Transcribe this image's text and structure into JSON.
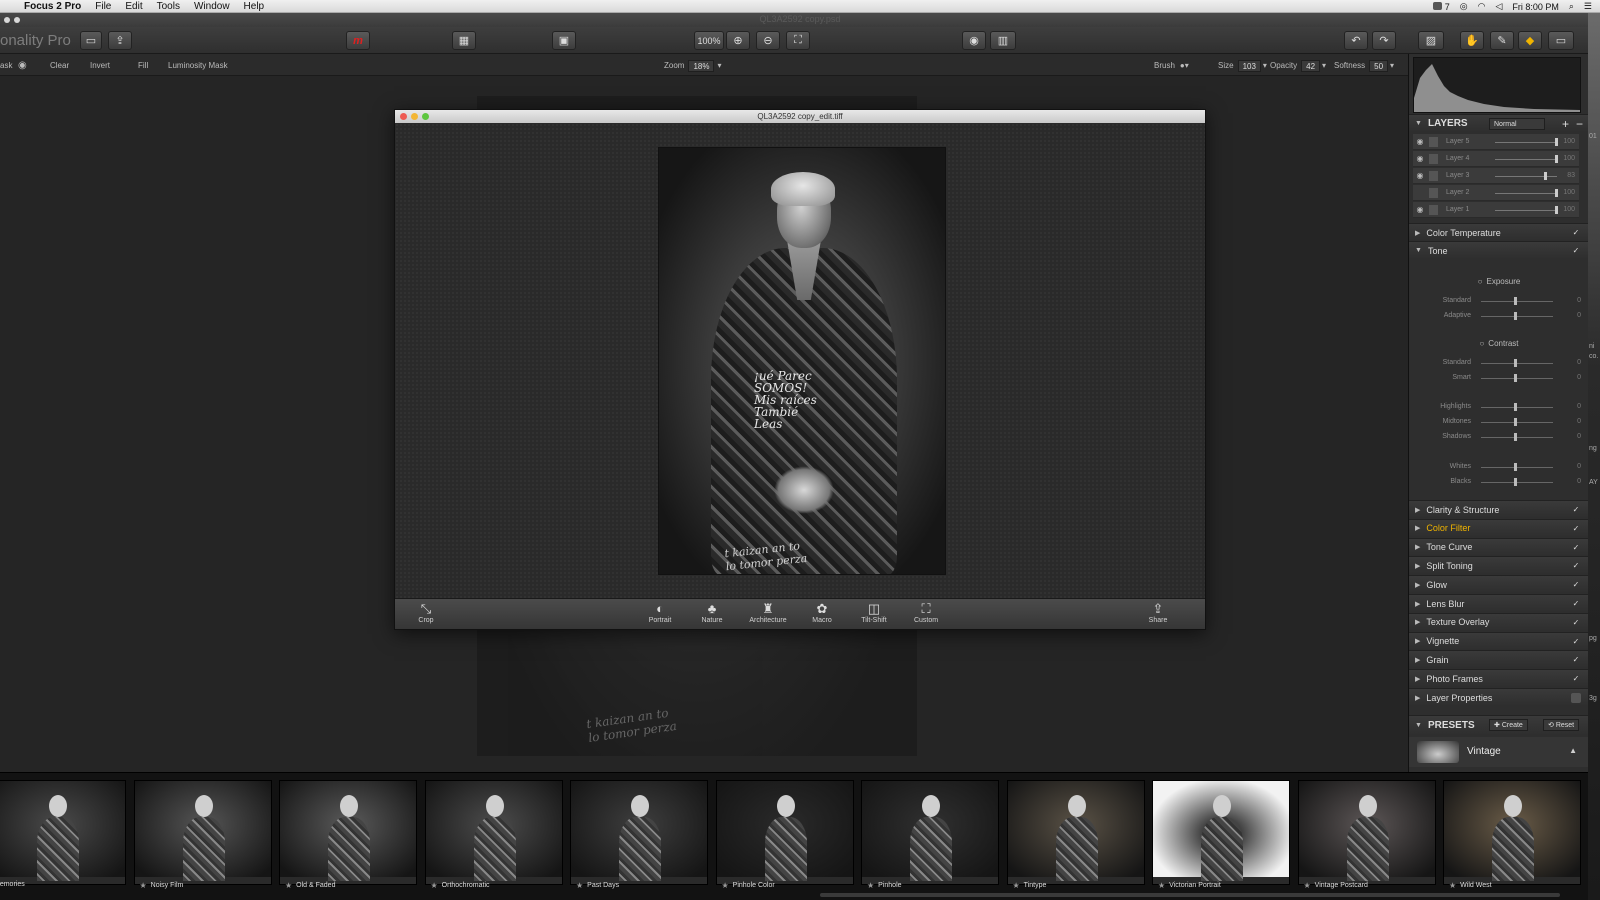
{
  "menubar": {
    "app": "Focus 2 Pro",
    "items": [
      "File",
      "Edit",
      "Tools",
      "Window",
      "Help"
    ],
    "status_badge": "7",
    "clock": "Fri 8:00 PM"
  },
  "titlebar": {
    "doc": "QL3A2592 copy.psd"
  },
  "toolbar": {
    "app_name": "onality Pro",
    "zoom_label": "100%"
  },
  "subbar": {
    "mask_label": "ask",
    "clear": "Clear",
    "invert": "Invert",
    "fill": "Fill",
    "luminosity": "Luminosity Mask",
    "zoom_label": "Zoom",
    "zoom_value": "18%",
    "brush_label": "Brush",
    "size_label": "Size",
    "size_value": "103",
    "opacity_label": "Opacity",
    "opacity_value": "42",
    "softness_label": "Softness",
    "softness_value": "50"
  },
  "window": {
    "title": "QL3A2592 copy_edit.tiff",
    "photo_text": "¡ué Parec\nSOMOS!\nMis raíces\nTambié\nLeas",
    "photo_script": "t kaizan an to\nlo tomor perza",
    "bg_script": "t kaizan an to\nlo tomor perza",
    "categories": [
      {
        "label": "Crop",
        "icon": "⤡"
      },
      {
        "label": "Portrait",
        "icon": "◐"
      },
      {
        "label": "Nature",
        "icon": "♣"
      },
      {
        "label": "Architecture",
        "icon": "♜"
      },
      {
        "label": "Macro",
        "icon": "✿"
      },
      {
        "label": "Tilt-Shift",
        "icon": "◫"
      },
      {
        "label": "Custom",
        "icon": "⛶"
      }
    ],
    "share": {
      "label": "Share",
      "icon": "⇪"
    }
  },
  "panel": {
    "layers_title": "LAYERS",
    "blend_mode": "Normal",
    "layers": [
      {
        "name": "Layer 5",
        "value": "100",
        "level": 1.0,
        "visible": true
      },
      {
        "name": "Layer 4",
        "value": "100",
        "level": 1.0,
        "visible": true
      },
      {
        "name": "Layer 3",
        "value": "83",
        "level": 0.83,
        "visible": true
      },
      {
        "name": "Layer 2",
        "value": "100",
        "level": 1.0,
        "visible": false
      },
      {
        "name": "Layer 1",
        "value": "100",
        "level": 1.0,
        "visible": true
      }
    ],
    "sections_top": [
      {
        "name": "Color Temperature",
        "open": false
      },
      {
        "name": "Tone",
        "open": true
      }
    ],
    "tone": {
      "exposure": "Exposure",
      "exposure_rows": [
        {
          "label": "Standard",
          "value": "0"
        },
        {
          "label": "Adaptive",
          "value": "0"
        }
      ],
      "contrast": "Contrast",
      "contrast_rows": [
        {
          "label": "Standard",
          "value": "0"
        },
        {
          "label": "Smart",
          "value": "0"
        }
      ],
      "tone_rows": [
        {
          "label": "Highlights",
          "value": "0"
        },
        {
          "label": "Midtones",
          "value": "0"
        },
        {
          "label": "Shadows",
          "value": "0"
        }
      ],
      "wb_rows": [
        {
          "label": "Whites",
          "value": "0"
        },
        {
          "label": "Blacks",
          "value": "0"
        }
      ]
    },
    "sections": [
      {
        "name": "Clarity & Structure",
        "checked": true,
        "highlight": false
      },
      {
        "name": "Color Filter",
        "checked": true,
        "highlight": true
      },
      {
        "name": "Tone Curve",
        "checked": true,
        "highlight": false
      },
      {
        "name": "Split Toning",
        "checked": true,
        "highlight": false
      },
      {
        "name": "Glow",
        "checked": true,
        "highlight": false
      },
      {
        "name": "Lens Blur",
        "checked": true,
        "highlight": false
      },
      {
        "name": "Texture Overlay",
        "checked": true,
        "highlight": false
      },
      {
        "name": "Vignette",
        "checked": true,
        "highlight": false
      },
      {
        "name": "Grain",
        "checked": true,
        "highlight": false
      },
      {
        "name": "Photo Frames",
        "checked": true,
        "highlight": false
      },
      {
        "name": "Layer Properties",
        "checked": false,
        "highlight": false
      }
    ],
    "presets_title": "PRESETS",
    "create": "Create",
    "reset": "Reset",
    "preset_name": "Vintage",
    "accent": "#f0b400"
  },
  "filmstrip": [
    {
      "name": "Memories",
      "tone": "#4a4a4a"
    },
    {
      "name": "Noisy Film",
      "tone": "#555555"
    },
    {
      "name": "Old & Faded",
      "tone": "#5a5a5a"
    },
    {
      "name": "Orthochromatic",
      "tone": "#4c4c4c"
    },
    {
      "name": "Past Days",
      "tone": "#3e3e3e"
    },
    {
      "name": "Pinhole Color",
      "tone": "#2a2a2a"
    },
    {
      "name": "Pinhole",
      "tone": "#303030"
    },
    {
      "name": "Tintype",
      "tone": "#5a5246"
    },
    {
      "name": "Victorian Portrait",
      "tone": "#e8e8e8"
    },
    {
      "name": "Vintage Postcard",
      "tone": "#5c5656"
    },
    {
      "name": "Wild West",
      "tone": "#6a5c48"
    }
  ],
  "edge_labels": [
    "01",
    "ni",
    "co.",
    "ng",
    "AY",
    "pg",
    "3g"
  ]
}
